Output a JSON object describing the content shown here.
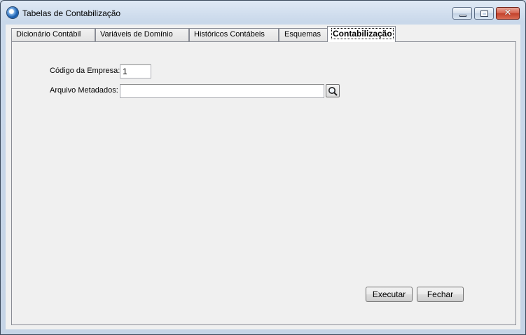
{
  "window": {
    "title": "Tabelas de Contabilização",
    "controls": {
      "minimize": "minimize",
      "maximize": "maximize",
      "close": "✕"
    }
  },
  "tabs": [
    {
      "label": "Dicionário Contábil",
      "active": false
    },
    {
      "label": "Variáveis de Domínio",
      "active": false
    },
    {
      "label": "Históricos Contábeis",
      "active": false
    },
    {
      "label": "Esquemas",
      "active": false
    },
    {
      "label": "Contabilização",
      "active": true
    }
  ],
  "form": {
    "empresa_label": "Código da Empresa:",
    "empresa_value": "1",
    "arquivo_label": "Arquivo Metadados:",
    "arquivo_value": ""
  },
  "buttons": {
    "executar": "Executar",
    "fechar": "Fechar"
  },
  "icons": {
    "app": "app-globe-icon",
    "lookup": "search-icon"
  }
}
